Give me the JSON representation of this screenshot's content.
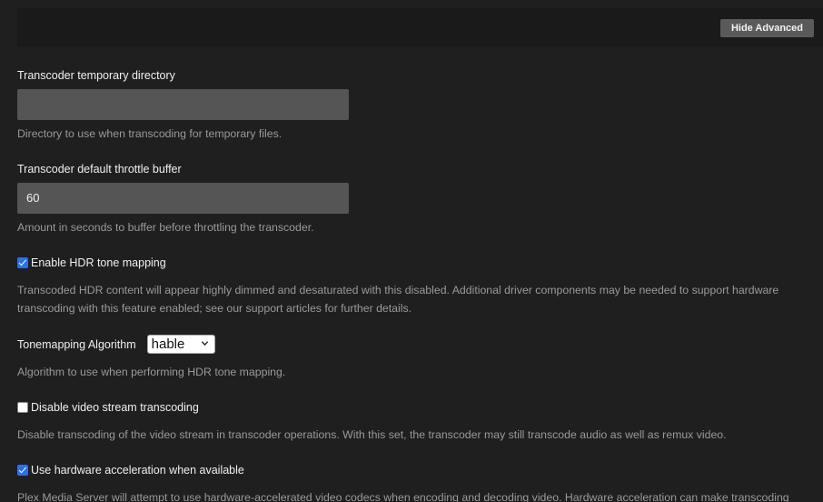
{
  "toolbar": {
    "hide_advanced_label": "Hide Advanced"
  },
  "settings": {
    "temp_dir": {
      "label": "Transcoder temporary directory",
      "value": "",
      "help": "Directory to use when transcoding for temporary files."
    },
    "throttle_buffer": {
      "label": "Transcoder default throttle buffer",
      "value": "60",
      "help": "Amount in seconds to buffer before throttling the transcoder."
    },
    "hdr_tone_mapping": {
      "label": "Enable HDR tone mapping",
      "checked": true,
      "help": "Transcoded HDR content will appear highly dimmed and desaturated with this disabled. Additional driver components may be needed to support hardware transcoding with this feature enabled; see our support articles for further details."
    },
    "tonemapping_algorithm": {
      "label": "Tonemapping Algorithm",
      "value": "hable",
      "help": "Algorithm to use when performing HDR tone mapping."
    },
    "disable_video_transcoding": {
      "label": "Disable video stream transcoding",
      "checked": false,
      "help": "Disable transcoding of the video stream in transcoder operations. With this set, the transcoder may still transcode audio as well as remux video."
    },
    "hardware_acceleration": {
      "label": "Use hardware acceleration when available",
      "checked": true,
      "help": "Plex Media Server will attempt to use hardware-accelerated video codecs when encoding and decoding video. Hardware acceleration can make transcoding"
    }
  },
  "colors": {
    "background": "#1f1f1f",
    "input_bg": "#555555",
    "checkbox_accent": "#2f6fe4",
    "help_text": "#9a9a9a"
  },
  "icons": {
    "select_chevron": "chevron-down-icon",
    "checkbox_check": "checkmark-icon"
  }
}
